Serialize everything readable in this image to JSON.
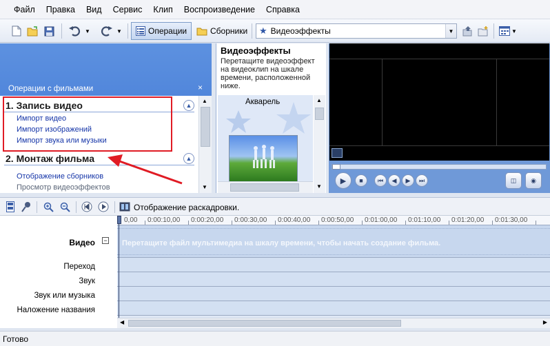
{
  "menu": [
    "Файл",
    "Правка",
    "Вид",
    "Сервис",
    "Клип",
    "Воспроизведение",
    "Справка"
  ],
  "toolbar": {
    "tasks_label": "Операции",
    "collections_label": "Сборники",
    "collection_combo": "Видеоэффекты"
  },
  "tasks_pane": {
    "header": "Операции с фильмами",
    "close": "×",
    "section1": {
      "title": "1. Запись видео",
      "links": [
        "Импорт видео",
        "Импорт изображений",
        "Импорт звука или музыки"
      ]
    },
    "section2": {
      "title": "2. Монтаж фильма",
      "links": [
        "Отображение сборников",
        "Просмотр видеоэффектов"
      ]
    }
  },
  "effects_pane": {
    "title": "Видеоэффекты",
    "description": "Перетащите видеоэффект на видеоклип на шкале времени, расположенной ниже.",
    "effect_name": "Акварель"
  },
  "storyboard": {
    "view_label": "Отображение раскадровки."
  },
  "timeline": {
    "ticks": [
      "0,00",
      "0:00:10,00",
      "0:00:20,00",
      "0:00:30,00",
      "0:00:40,00",
      "0:00:50,00",
      "0:01:00,00",
      "0:01:10,00",
      "0:01:20,00",
      "0:01:30,00"
    ],
    "tracks": {
      "video": "Видео",
      "transition": "Переход",
      "audio": "Звук",
      "music": "Звук или музыка",
      "title_overlay": "Наложение названия"
    },
    "collapse": "−",
    "drop_hint": "Перетащите файл мультимедиа на шкалу времени, чтобы начать создание фильма."
  },
  "status": "Готово",
  "colors": {
    "highlight": "#e01b24",
    "link": "#1535a8",
    "pane_blue": "#3b73d1"
  }
}
